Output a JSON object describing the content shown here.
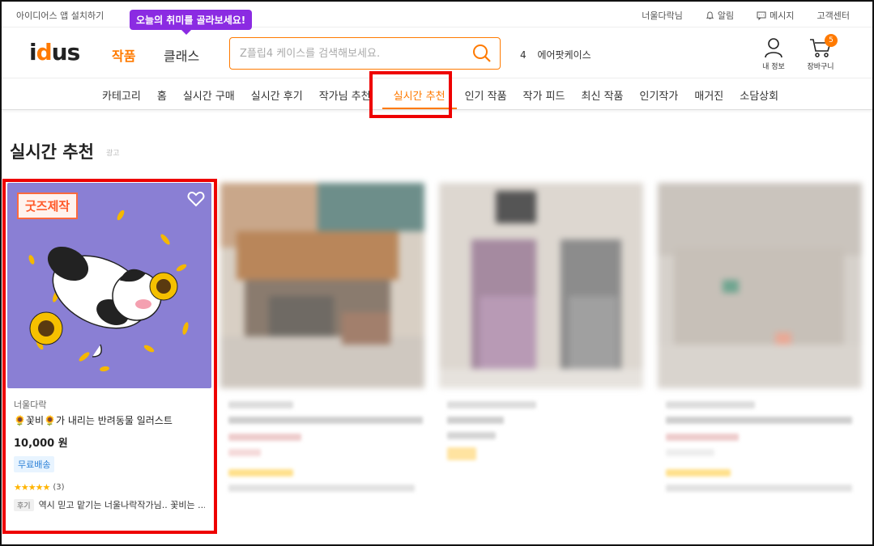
{
  "topbar": {
    "app_install": "아이디어스 앱 설치하기",
    "tooltip": "오늘의 취미를 골라보세요!",
    "links": [
      "너울다락님",
      "알림",
      "메시지",
      "고객센터"
    ]
  },
  "header": {
    "logo": "idus",
    "nav_products": "작품",
    "nav_class": "클래스",
    "search_placeholder": "Z플립4 케이스를 검색해보세요.",
    "ranking_num": "4",
    "ranking_term": "에어팟케이스",
    "my_info": "내 정보",
    "cart": "장바구니",
    "cart_count": "5"
  },
  "categories": [
    "카테고리",
    "홈",
    "실시간 구매",
    "실시간 후기",
    "작가님 추천",
    "실시간 추천",
    "인기 작품",
    "작가 피드",
    "최신 작품",
    "인기작가",
    "매거진",
    "소담상회"
  ],
  "active_category": "실시간 추천",
  "section": {
    "title": "실시간 추천",
    "ad_label": "광고"
  },
  "product": {
    "badge": "굿즈제작",
    "artist": "너울다락",
    "title": "🌻꽃비🌻가 내리는 반려동물 일러스트",
    "price": "10,000 원",
    "shipping": "무료배송",
    "stars": "★★★★★",
    "review_count": "(3)",
    "review_tag": "후기",
    "review_text": "역시 믿고 맡기는 너울나락작가님.. 꽃비는 ..."
  },
  "colors": {
    "accent": "#ff7a00",
    "tooltip": "#8b2be2",
    "highlight": "#ee0000",
    "card_bg": "#8a7fd4"
  }
}
